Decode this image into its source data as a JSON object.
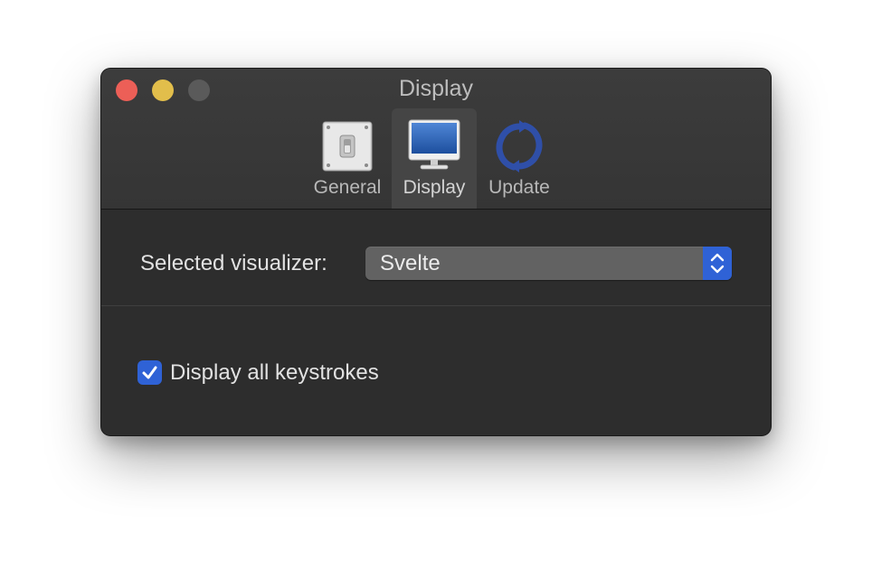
{
  "window": {
    "title": "Display"
  },
  "toolbar": {
    "tabs": [
      {
        "label": "General",
        "icon": "general-switch-icon",
        "selected": false
      },
      {
        "label": "Display",
        "icon": "monitor-icon",
        "selected": true
      },
      {
        "label": "Update",
        "icon": "refresh-icon",
        "selected": false
      }
    ]
  },
  "settings": {
    "visualizer_label": "Selected visualizer:",
    "visualizer_value": "Svelte",
    "keystrokes_label": "Display all keystrokes",
    "keystrokes_checked": true
  },
  "colors": {
    "accent": "#2f62d6",
    "close": "#ec5f57",
    "minimize": "#e2be4b",
    "zoom_inactive": "#5a5a5a",
    "window_bg": "#2d2d2d"
  }
}
